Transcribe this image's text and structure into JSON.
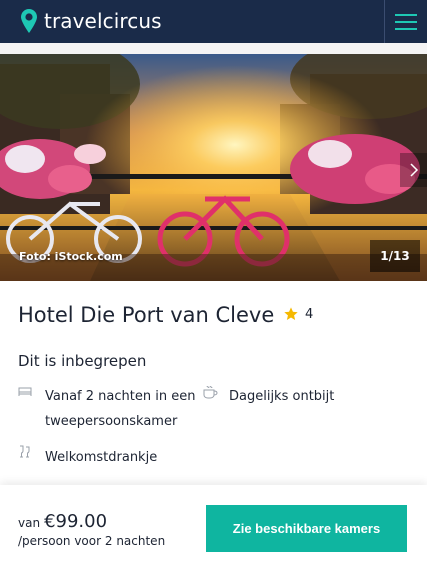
{
  "header": {
    "logo_text": "travelcircus",
    "menu_icon": "hamburger-menu-icon",
    "background_color": "#1a2b49",
    "accent_color": "#1ec8b4"
  },
  "gallery": {
    "photo_credit": "Foto: iStock.com",
    "counter": "1/13",
    "next_icon": "chevron-right-icon"
  },
  "hotel": {
    "name": "Hotel Die Port van Cleve",
    "star_icon": "star-icon",
    "rating": "4"
  },
  "included": {
    "title": "Dit is inbegrepen",
    "items": [
      {
        "icon": "bed-icon",
        "line1": "Vanaf 2 nachten in een",
        "line2": "tweepersoonskamer"
      },
      {
        "icon": "coffee-cup-icon",
        "line1": "Dagelijks ontbijt"
      },
      {
        "icon": "drinks-glasses-icon",
        "line1": "Welkomstdrankje"
      }
    ]
  },
  "footer": {
    "price_prefix": "van",
    "price": "€99.00",
    "price_note": "/persoon voor 2 nachten",
    "cta_label": "Zie beschikbare kamers",
    "cta_color": "#0fb5a0"
  }
}
